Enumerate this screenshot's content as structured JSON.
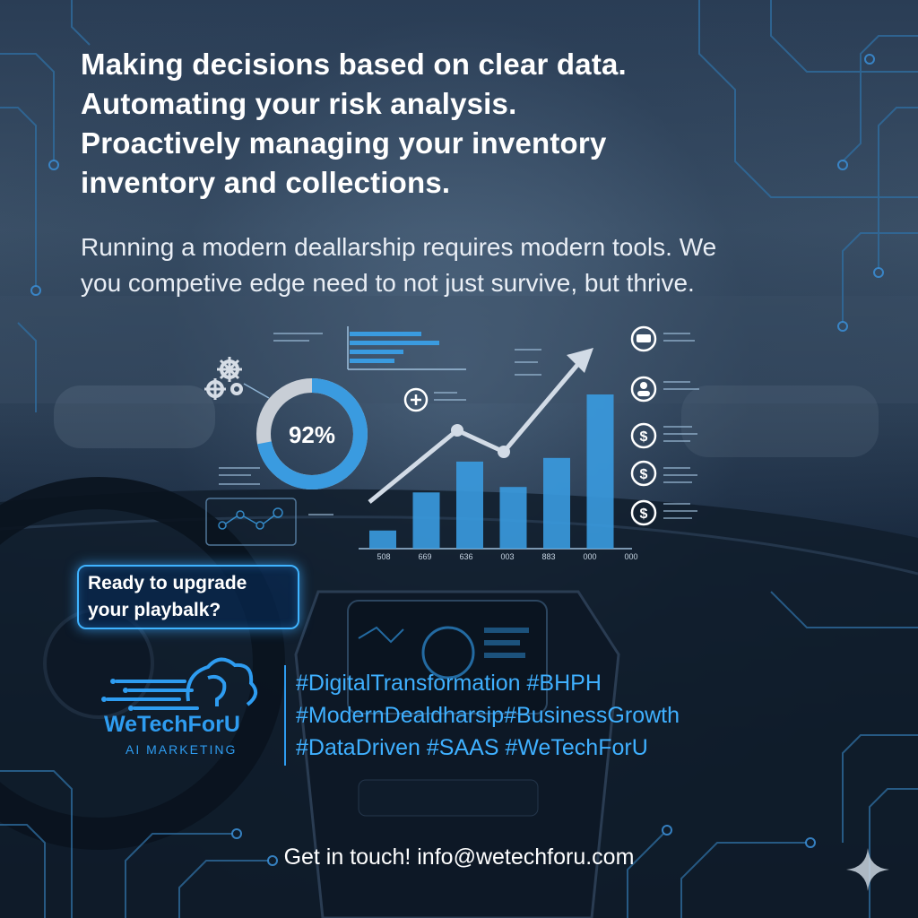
{
  "headline": {
    "line1": "Making decisions based on clear data.",
    "line2": "Automating your risk analysis.",
    "line3": "Proactively managing your inventory",
    "line4": "inventory and collections."
  },
  "subtext": {
    "line1": "Running a modern deallarship requires modern tools. We",
    "line2": "you competive edge need to not just survive, but thrive."
  },
  "dashboard": {
    "donut_label": "92%",
    "donut_fraction": 0.72,
    "bar_values": [
      20,
      62,
      96,
      68,
      100,
      170
    ],
    "bar_axis_labels": [
      "508",
      "669",
      "636",
      "003",
      "883",
      "000",
      "000"
    ],
    "accent_color": "#3a9be0"
  },
  "cta": {
    "line1": "Ready to upgrade",
    "line2": "your playbalk?"
  },
  "logo": {
    "name": "WeTechForU",
    "tagline": "AI MARKETING"
  },
  "hashtags": {
    "line1": "#DigitalTransformation #BHPH",
    "line2": "#ModernDealdharsip#BusinessGrowth",
    "line3": "#DataDriven #SAAS #WeTechForU"
  },
  "contact": "Get in touch! info@wetechforu.com",
  "colors": {
    "brand_blue": "#2e9cf0",
    "cta_border": "#3fb3ff",
    "background": "#0c1a2b"
  },
  "icons": [
    "gear-icon",
    "donut-chart",
    "bar-chart",
    "trend-arrow-icon",
    "car-icon",
    "person-icon",
    "dollar-icon",
    "sparkle-icon"
  ]
}
